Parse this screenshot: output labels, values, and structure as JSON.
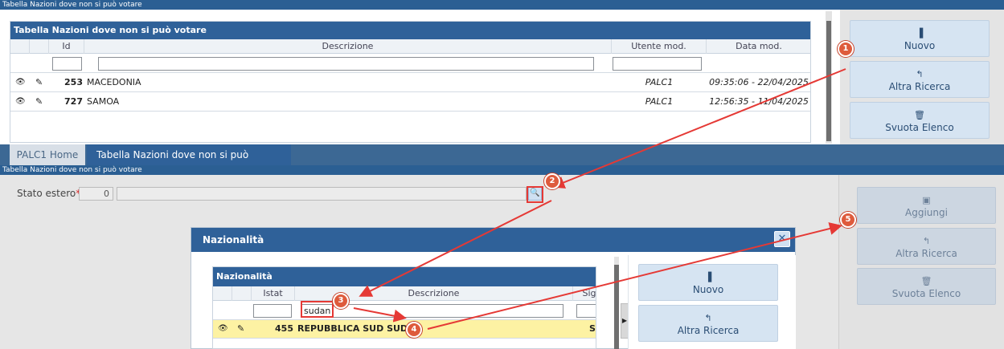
{
  "top": {
    "window_title": "Tabella Nazioni dove non si può votare",
    "grid_title": "Tabella Nazioni dove non si può votare",
    "columns": [
      "Id",
      "Descrizione",
      "Utente mod.",
      "Data mod."
    ],
    "rows": [
      {
        "id": "253",
        "descrizione": "MACEDONIA",
        "utente": "PALC1",
        "data": "09:35:06 - 22/04/2025"
      },
      {
        "id": "727",
        "descrizione": "SAMOA",
        "utente": "PALC1",
        "data": "12:56:35 - 11/04/2025"
      }
    ],
    "buttons": [
      {
        "label": "Nuovo",
        "icon": "document-icon"
      },
      {
        "label": "Altra Ricerca",
        "icon": "undo-icon"
      },
      {
        "label": "Svuota Elenco",
        "icon": "trash-icon"
      }
    ]
  },
  "tabs": [
    {
      "label": "PALC1 Home"
    },
    {
      "label": "Tabella Nazioni dove non si può votare"
    }
  ],
  "form": {
    "window_title": "Tabella Nazioni dove non si può votare",
    "field_label": "Stato estero",
    "required_mark": "*",
    "code_value": "0",
    "buttons": [
      {
        "label": "Aggiungi",
        "icon": "save-icon"
      },
      {
        "label": "Altra Ricerca",
        "icon": "undo-icon"
      },
      {
        "label": "Svuota Elenco",
        "icon": "trash-icon"
      }
    ]
  },
  "modal": {
    "title": "Nazionalità",
    "grid_title": "Nazionalità",
    "columns": [
      "Istat",
      "Descrizione",
      "Sig"
    ],
    "filter_descrizione": "sudan",
    "rows": [
      {
        "istat": "455",
        "descrizione": "REPUBBLICA SUD SUDAN",
        "sigla": "SU"
      }
    ],
    "buttons": [
      {
        "label": "Nuovo",
        "icon": "document-icon"
      },
      {
        "label": "Altra Ricerca",
        "icon": "undo-icon"
      }
    ]
  },
  "callouts": [
    "1",
    "2",
    "3",
    "4",
    "5"
  ],
  "colors": {
    "header": "#2f6199",
    "button": "#d6e4f2",
    "selected_row": "#fdf2a3",
    "callout": "#de5b3c",
    "arrow": "#e53935"
  }
}
